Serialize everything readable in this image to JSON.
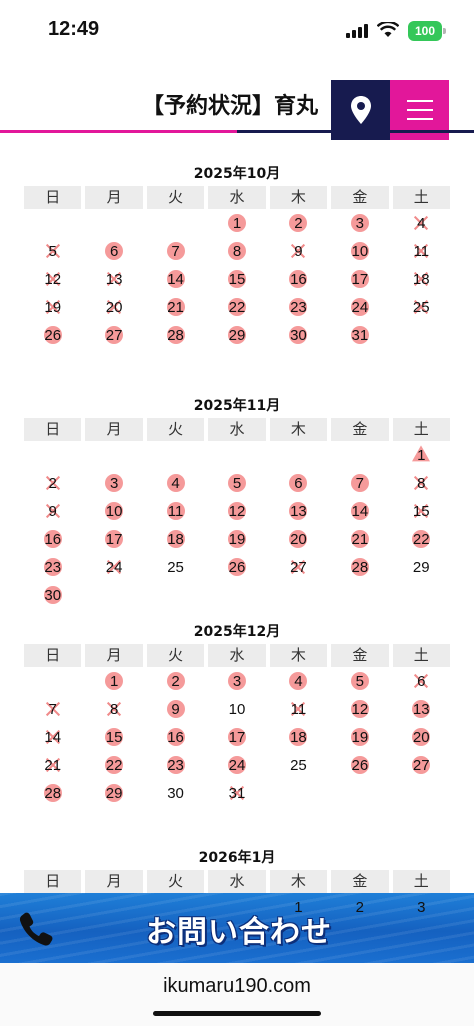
{
  "status": {
    "time": "12:49",
    "battery": "100"
  },
  "header": {
    "title": "【予約状況】育丸"
  },
  "weekdays": [
    "日",
    "月",
    "火",
    "水",
    "木",
    "金",
    "土"
  ],
  "months": [
    {
      "title": "2025年10月",
      "start": 3,
      "days": [
        {
          "d": "1",
          "s": "avail"
        },
        {
          "d": "2",
          "s": "avail"
        },
        {
          "d": "3",
          "s": "avail"
        },
        {
          "d": "4",
          "s": "full"
        },
        {
          "d": "5",
          "s": "full"
        },
        {
          "d": "6",
          "s": "avail"
        },
        {
          "d": "7",
          "s": "avail"
        },
        {
          "d": "8",
          "s": "avail"
        },
        {
          "d": "9",
          "s": "full"
        },
        {
          "d": "10",
          "s": "avail"
        },
        {
          "d": "11",
          "s": "full"
        },
        {
          "d": "12",
          "s": "full"
        },
        {
          "d": "13",
          "s": "full"
        },
        {
          "d": "14",
          "s": "avail"
        },
        {
          "d": "15",
          "s": "avail"
        },
        {
          "d": "16",
          "s": "avail"
        },
        {
          "d": "17",
          "s": "avail"
        },
        {
          "d": "18",
          "s": "full"
        },
        {
          "d": "19",
          "s": "full"
        },
        {
          "d": "20",
          "s": "full"
        },
        {
          "d": "21",
          "s": "avail"
        },
        {
          "d": "22",
          "s": "avail"
        },
        {
          "d": "23",
          "s": "avail"
        },
        {
          "d": "24",
          "s": "avail"
        },
        {
          "d": "25",
          "s": "full"
        },
        {
          "d": "26",
          "s": "avail"
        },
        {
          "d": "27",
          "s": "avail"
        },
        {
          "d": "28",
          "s": "avail"
        },
        {
          "d": "29",
          "s": "avail"
        },
        {
          "d": "30",
          "s": "avail"
        },
        {
          "d": "31",
          "s": "avail"
        }
      ]
    },
    {
      "title": "2025年11月",
      "start": 6,
      "days": [
        {
          "d": "1",
          "s": "tri"
        },
        {
          "d": "2",
          "s": "full"
        },
        {
          "d": "3",
          "s": "avail"
        },
        {
          "d": "4",
          "s": "avail"
        },
        {
          "d": "5",
          "s": "avail"
        },
        {
          "d": "6",
          "s": "avail"
        },
        {
          "d": "7",
          "s": "avail"
        },
        {
          "d": "8",
          "s": "full"
        },
        {
          "d": "9",
          "s": "full"
        },
        {
          "d": "10",
          "s": "avail"
        },
        {
          "d": "11",
          "s": "avail"
        },
        {
          "d": "12",
          "s": "avail"
        },
        {
          "d": "13",
          "s": "avail"
        },
        {
          "d": "14",
          "s": "avail"
        },
        {
          "d": "15",
          "s": "full"
        },
        {
          "d": "16",
          "s": "avail"
        },
        {
          "d": "17",
          "s": "avail"
        },
        {
          "d": "18",
          "s": "avail"
        },
        {
          "d": "19",
          "s": "avail"
        },
        {
          "d": "20",
          "s": "avail"
        },
        {
          "d": "21",
          "s": "avail"
        },
        {
          "d": "22",
          "s": "avail"
        },
        {
          "d": "23",
          "s": "avail"
        },
        {
          "d": "24",
          "s": "full"
        },
        {
          "d": "25",
          "s": "none"
        },
        {
          "d": "26",
          "s": "avail"
        },
        {
          "d": "27",
          "s": "full"
        },
        {
          "d": "28",
          "s": "avail"
        },
        {
          "d": "29",
          "s": "none"
        },
        {
          "d": "30",
          "s": "avail"
        }
      ]
    },
    {
      "title": "2025年12月",
      "start": 1,
      "days": [
        {
          "d": "1",
          "s": "avail"
        },
        {
          "d": "2",
          "s": "avail"
        },
        {
          "d": "3",
          "s": "avail"
        },
        {
          "d": "4",
          "s": "avail"
        },
        {
          "d": "5",
          "s": "avail"
        },
        {
          "d": "6",
          "s": "full"
        },
        {
          "d": "7",
          "s": "full"
        },
        {
          "d": "8",
          "s": "full"
        },
        {
          "d": "9",
          "s": "avail"
        },
        {
          "d": "10",
          "s": "none"
        },
        {
          "d": "11",
          "s": "full"
        },
        {
          "d": "12",
          "s": "avail"
        },
        {
          "d": "13",
          "s": "avail"
        },
        {
          "d": "14",
          "s": "full"
        },
        {
          "d": "15",
          "s": "avail"
        },
        {
          "d": "16",
          "s": "avail"
        },
        {
          "d": "17",
          "s": "avail"
        },
        {
          "d": "18",
          "s": "avail"
        },
        {
          "d": "19",
          "s": "avail"
        },
        {
          "d": "20",
          "s": "avail"
        },
        {
          "d": "21",
          "s": "full"
        },
        {
          "d": "22",
          "s": "avail"
        },
        {
          "d": "23",
          "s": "avail"
        },
        {
          "d": "24",
          "s": "avail"
        },
        {
          "d": "25",
          "s": "none"
        },
        {
          "d": "26",
          "s": "avail"
        },
        {
          "d": "27",
          "s": "avail"
        },
        {
          "d": "28",
          "s": "avail"
        },
        {
          "d": "29",
          "s": "avail"
        },
        {
          "d": "30",
          "s": "none"
        },
        {
          "d": "31",
          "s": "full"
        }
      ]
    },
    {
      "title": "2026年1月",
      "start": 4,
      "days": [
        {
          "d": "1",
          "s": "none"
        },
        {
          "d": "2",
          "s": "none"
        },
        {
          "d": "3",
          "s": "none"
        }
      ]
    }
  ],
  "contact": {
    "label": "お問い合わせ"
  },
  "browser": {
    "url": "ikumaru190.com"
  },
  "colors": {
    "pink": "#e2179a",
    "navy": "#171b4f",
    "mark": "#f59a9a",
    "contact_blue": "#1561c0"
  }
}
